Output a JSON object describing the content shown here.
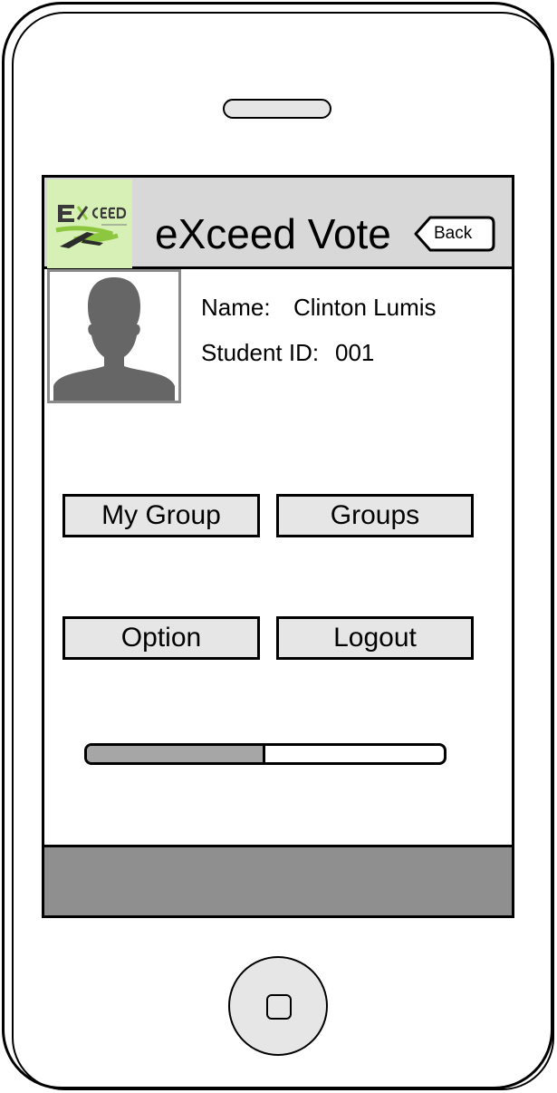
{
  "header": {
    "logo_text": "EXCEED",
    "title": "eXceed Vote",
    "back_label": "Back"
  },
  "profile": {
    "name_label": "Name:",
    "name_value": "Clinton Lumis",
    "student_id_label": "Student ID:",
    "student_id_value": "001"
  },
  "menu": {
    "my_group": "My Group",
    "groups": "Groups",
    "option": "Option",
    "logout": "Logout"
  },
  "progress": {
    "fraction": 0.5
  },
  "colors": {
    "header_bg": "#d8d8d8",
    "logo_bg": "#d7f0b5",
    "logo_accent": "#8dc63f",
    "button_bg": "#e6e6e6",
    "progress_fill": "#a6a6a6",
    "footer_bg": "#8f8f8f",
    "avatar_silhouette": "#666666"
  }
}
